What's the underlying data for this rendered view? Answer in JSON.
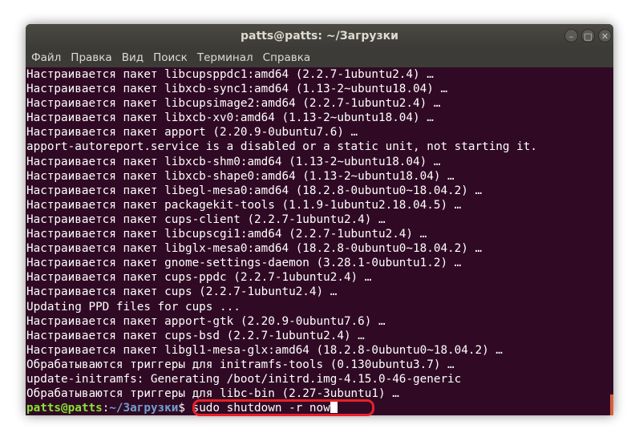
{
  "window": {
    "title": "patts@patts: ~/Загрузки",
    "buttons": {
      "minimize": "–",
      "maximize": "□",
      "close": "✕"
    }
  },
  "menu": [
    "Файл",
    "Правка",
    "Вид",
    "Поиск",
    "Терминал",
    "Справка"
  ],
  "terminal": {
    "lines": [
      "Настраивается пакет libcupsppdc1:amd64 (2.2.7-1ubuntu2.4) …",
      "Настраивается пакет libxcb-sync1:amd64 (1.13-2~ubuntu18.04) …",
      "Настраивается пакет libcupsimage2:amd64 (2.2.7-1ubuntu2.4) …",
      "Настраивается пакет libxcb-xv0:amd64 (1.13-2~ubuntu18.04) …",
      "Настраивается пакет apport (2.20.9-0ubuntu7.6) …",
      "apport-autoreport.service is a disabled or a static unit, not starting it.",
      "Настраивается пакет libxcb-shm0:amd64 (1.13-2~ubuntu18.04) …",
      "Настраивается пакет libxcb-shape0:amd64 (1.13-2~ubuntu18.04) …",
      "Настраивается пакет libegl-mesa0:amd64 (18.2.8-0ubuntu0~18.04.2) …",
      "Настраивается пакет packagekit-tools (1.1.9-1ubuntu2.18.04.5) …",
      "Настраивается пакет cups-client (2.2.7-1ubuntu2.4) …",
      "Настраивается пакет libcupscgi1:amd64 (2.2.7-1ubuntu2.4) …",
      "Настраивается пакет libglx-mesa0:amd64 (18.2.8-0ubuntu0~18.04.2) …",
      "Настраивается пакет gnome-settings-daemon (3.28.1-0ubuntu1.2) …",
      "Настраивается пакет cups-ppdc (2.2.7-1ubuntu2.4) …",
      "Настраивается пакет cups (2.2.7-1ubuntu2.4) …",
      "Updating PPD files for cups ...",
      "Настраивается пакет apport-gtk (2.20.9-0ubuntu7.6) …",
      "Настраивается пакет cups-bsd (2.2.7-1ubuntu2.4) …",
      "Настраивается пакет libgl1-mesa-glx:amd64 (18.2.8-0ubuntu0~18.04.2) …",
      "Обрабатываются триггеры для initramfs-tools (0.130ubuntu3.7) …",
      "update-initramfs: Generating /boot/initrd.img-4.15.0-46-generic",
      "Обрабатываются триггеры для libc-bin (2.27-3ubuntu1) …"
    ],
    "prompt": {
      "user": "patts@patts",
      "sep": ":",
      "path": "~/Загрузки",
      "symbol": "$ ",
      "command": "sudo shutdown -r now"
    }
  },
  "colors": {
    "terminal_bg": "#300a24",
    "prompt_user": "#8ae234",
    "prompt_path": "#729fcf",
    "highlight": "#e8202a"
  }
}
